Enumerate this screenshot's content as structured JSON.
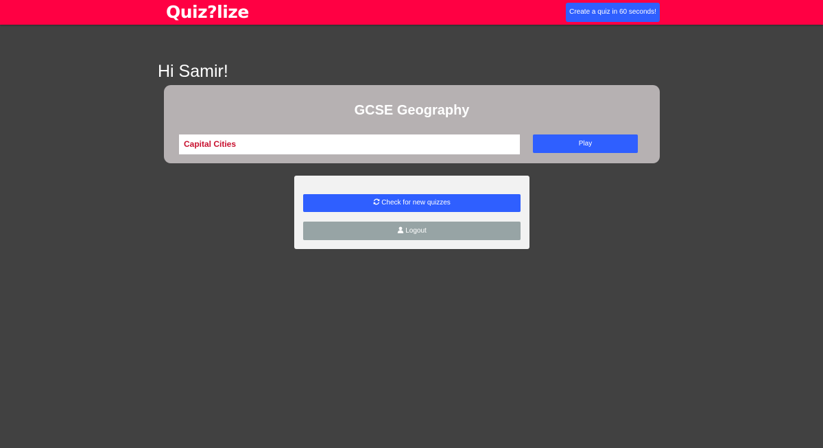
{
  "header": {
    "logo_text": "Quiz?lize",
    "create_button_label": "Create a quiz in 60 seconds!",
    "colors": {
      "bar": "#ff0043",
      "button": "#2f5fff"
    }
  },
  "greeting": "Hi Samir!",
  "subject": {
    "title": "GCSE Geography",
    "quizzes": [
      {
        "name": "Capital Cities",
        "action_label": "Play"
      }
    ]
  },
  "actions": {
    "check_label": "Check for new quizzes",
    "check_icon": "refresh-icon",
    "logout_label": "Logout",
    "logout_icon": "user-icon"
  },
  "colors": {
    "background": "#414141",
    "card": "#b6b1b2",
    "primary": "#2f5fff",
    "secondary": "#97a4a5",
    "quiz_name": "#c8102e"
  }
}
